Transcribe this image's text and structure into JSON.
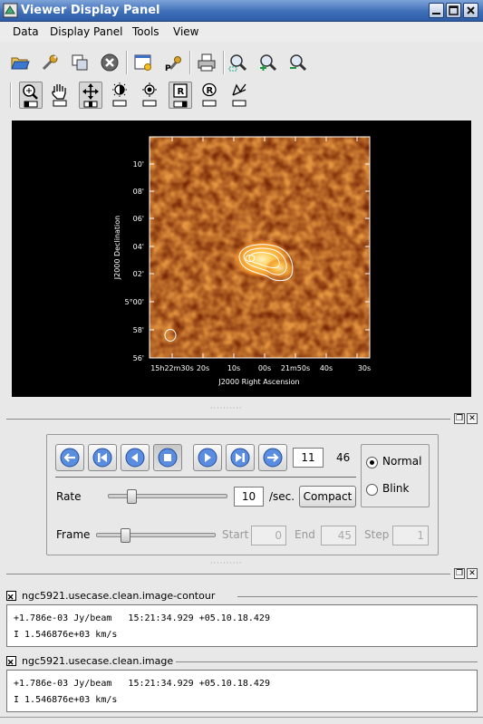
{
  "window": {
    "title": "Viewer Display Panel"
  },
  "menu": [
    {
      "label": "Data"
    },
    {
      "label": "Display Panel"
    },
    {
      "label": "Tools"
    },
    {
      "label": "View"
    }
  ],
  "toolbar": {
    "icons": [
      "open-folder-icon",
      "adjust-wrench-icon",
      "copy-panels-icon",
      "close-panel-icon",
      "panel-settings-icon",
      "print-settings-icon",
      "print-icon",
      "zoom-fit-icon",
      "zoom-in-icon",
      "zoom-out-icon"
    ]
  },
  "mouse_tools": {
    "icons": [
      "zoom-tool-icon",
      "pan-tool-icon",
      "move-tool-icon",
      "contrast-tool-icon",
      "brightness-tool-icon",
      "crosshair-position-icon",
      "rectangle-region-icon",
      "polygon-region-icon",
      "polyline-icon"
    ]
  },
  "image": {
    "ylabel": "J2000 Declination",
    "xlabel": "J2000 Right Ascension",
    "yticks": [
      "10'",
      "08'",
      "06'",
      "04'",
      "02'",
      "5°00'",
      "58'",
      "56'"
    ],
    "xticks": [
      "15h22m30s",
      "20s",
      "10s",
      "00s",
      "21m50s",
      "40s",
      "30s"
    ]
  },
  "animator": {
    "frame_current": "11",
    "frame_total": "46",
    "rate_label": "Rate",
    "rate_value": "10",
    "rate_unit": "/sec.",
    "compact_label": "Compact",
    "frame_label": "Frame",
    "start_label": "Start",
    "start_value": "0",
    "end_label": "End",
    "end_value": "45",
    "step_label": "Step",
    "step_value": "1",
    "mode_normal": "Normal",
    "mode_blink": "Blink",
    "mode_selected": "Normal",
    "rate_slider_position": 0.2,
    "frame_slider_position": 0.24
  },
  "tracking": [
    {
      "name": "ngc5921.usecase.clean.image-contour",
      "line1": "+1.786e-03 Jy/beam   15:21:34.929 +05.10.18.429",
      "line2": "I 1.546876e+03 km/s"
    },
    {
      "name": "ngc5921.usecase.clean.image",
      "line1": "+1.786e-03 Jy/beam   15:21:34.929 +05.10.18.429",
      "line2": "I 1.546876e+03 km/s"
    }
  ]
}
